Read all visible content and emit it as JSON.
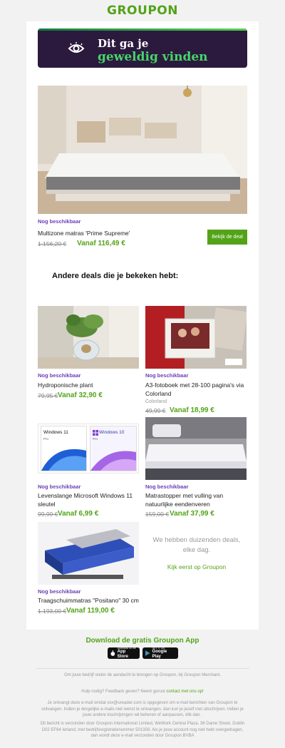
{
  "brand": {
    "logo_text": "GROUPON",
    "color": "#53a318"
  },
  "banner": {
    "line1": "Dit ga je",
    "line2": "geweldig vinden",
    "bg": "#2b1a3d",
    "accent": "#46d46a",
    "icon": "eye-icon"
  },
  "hero_deal": {
    "availability": "Nog beschikbaar",
    "title": "Multizone matras 'Prime Supreme'",
    "original_price": "1.156,20 €",
    "price": "Vanaf 116,49 €",
    "button_label": "Bekijk de deal"
  },
  "section_heading": "Andere deals die je bekeken hebt:",
  "deals": [
    {
      "availability": "Nog beschikbaar",
      "title": "Hydroponische plant",
      "original_price": "79,95 €",
      "price": "Vanaf 32,90 €"
    },
    {
      "availability": "Nog beschikbaar",
      "title": "A3-fotoboek met 28-100 pagina's via Colorland",
      "brand": "Colorland",
      "original_price": "49,99 €",
      "price": "Vanaf 18,99 €"
    },
    {
      "availability": "Nog beschikbaar",
      "title": "Levenslange Microsoft Windows 11 sleutel",
      "original_price": "99,99 €",
      "price": "Vanaf 6,99 €",
      "image_labels": [
        "Windows 11",
        "Windows 10",
        "Pro",
        "Pro"
      ]
    },
    {
      "availability": "Nog beschikbaar",
      "title": "Matrastopper met vulling van natuurlijke eendenveren",
      "original_price": "159,00 €",
      "price": "Vanaf 37,99 €"
    },
    {
      "availability": "Nog beschikbaar",
      "title": "Traagschuimmatras \"Positano\" 30 cm",
      "original_price": "1.193,00 €",
      "price": "Vanaf 119,00 €"
    }
  ],
  "promo": {
    "text": "We hebben duizenden deals, elke dag.",
    "link": "Kijk eerst op Groupon"
  },
  "app": {
    "heading": "Download de gratis Groupon App",
    "app_store": {
      "small": "Download on the",
      "big": "App Store"
    },
    "google_play": {
      "small": "GET IT ON",
      "big": "Google Play"
    }
  },
  "footer": {
    "line1": "Om jouw bedrijf onder de aandacht te brengen op Groupon, bij Groupon Merchant.",
    "help_prefix": "Hulp nodig? Feedback geven? Neem gerust",
    "help_link": "contact met ons op!",
    "para1": "Je ontvangt deze e-mail omdat xxx@ureader.com is opgegeven om e-mail berichten van Groupon te ontvangen. Indien je dergelijke e-mails niet wenst te ontvangen, dan kun je jezelf met uitschrijven. Indien je jouw andere inschrijvingen wil beheren of aanpassen, klik dan .",
    "para2": "Dit bericht is verzonden door Groupon International Limited, WeWork Central Plaza, 36 Dame Street, Dublin D02 EF64 Ierland, met bedrijfsregistratienummer 501358. Als je jouw account nog niet hebt overgedragen, dan wordt deze e-mail verzonden door Groupon BVBA"
  }
}
